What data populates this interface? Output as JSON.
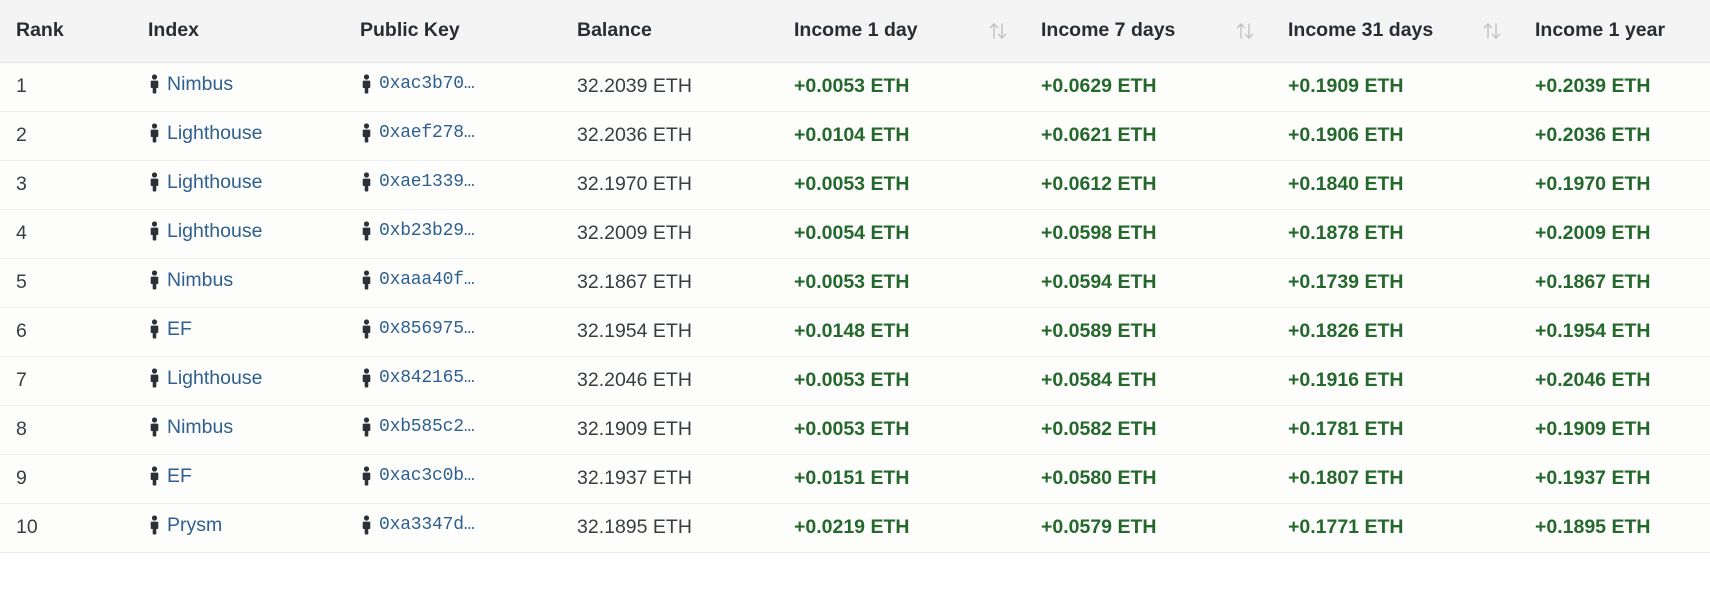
{
  "table": {
    "columns": [
      {
        "key": "rank",
        "label": "Rank",
        "sortable": false
      },
      {
        "key": "index",
        "label": "Index",
        "sortable": false
      },
      {
        "key": "pubkey",
        "label": "Public Key",
        "sortable": false
      },
      {
        "key": "balance",
        "label": "Balance",
        "sortable": false
      },
      {
        "key": "income1d",
        "label": "Income 1 day",
        "sortable": true
      },
      {
        "key": "income7d",
        "label": "Income 7 days",
        "sortable": true
      },
      {
        "key": "income31d",
        "label": "Income 31 days",
        "sortable": true
      },
      {
        "key": "income1y",
        "label": "Income 1 year",
        "sortable": true
      }
    ],
    "sort_icon_name": "sort-updown-icon",
    "row_icon_name": "validator-person-icon",
    "colors": {
      "header_bg": "#f4f4f4",
      "row_bg": "#fdfdfc",
      "link": "#2e5f8f",
      "income_positive": "#24682c",
      "text": "#383d42",
      "border": "#ededed",
      "icon": "#2c3138"
    },
    "rows": [
      {
        "rank": "1",
        "index": "Nimbus",
        "pubkey": "0xac3b70…",
        "balance": "32.2039 ETH",
        "income1d": "+0.0053 ETH",
        "income7d": "+0.0629 ETH",
        "income31d": "+0.1909 ETH",
        "income1y": "+0.2039 ETH"
      },
      {
        "rank": "2",
        "index": "Lighthouse",
        "pubkey": "0xaef278…",
        "balance": "32.2036 ETH",
        "income1d": "+0.0104 ETH",
        "income7d": "+0.0621 ETH",
        "income31d": "+0.1906 ETH",
        "income1y": "+0.2036 ETH"
      },
      {
        "rank": "3",
        "index": "Lighthouse",
        "pubkey": "0xae1339…",
        "balance": "32.1970 ETH",
        "income1d": "+0.0053 ETH",
        "income7d": "+0.0612 ETH",
        "income31d": "+0.1840 ETH",
        "income1y": "+0.1970 ETH"
      },
      {
        "rank": "4",
        "index": "Lighthouse",
        "pubkey": "0xb23b29…",
        "balance": "32.2009 ETH",
        "income1d": "+0.0054 ETH",
        "income7d": "+0.0598 ETH",
        "income31d": "+0.1878 ETH",
        "income1y": "+0.2009 ETH"
      },
      {
        "rank": "5",
        "index": "Nimbus",
        "pubkey": "0xaaa40f…",
        "balance": "32.1867 ETH",
        "income1d": "+0.0053 ETH",
        "income7d": "+0.0594 ETH",
        "income31d": "+0.1739 ETH",
        "income1y": "+0.1867 ETH"
      },
      {
        "rank": "6",
        "index": "EF",
        "pubkey": "0x856975…",
        "balance": "32.1954 ETH",
        "income1d": "+0.0148 ETH",
        "income7d": "+0.0589 ETH",
        "income31d": "+0.1826 ETH",
        "income1y": "+0.1954 ETH"
      },
      {
        "rank": "7",
        "index": "Lighthouse",
        "pubkey": "0x842165…",
        "balance": "32.2046 ETH",
        "income1d": "+0.0053 ETH",
        "income7d": "+0.0584 ETH",
        "income31d": "+0.1916 ETH",
        "income1y": "+0.2046 ETH"
      },
      {
        "rank": "8",
        "index": "Nimbus",
        "pubkey": "0xb585c2…",
        "balance": "32.1909 ETH",
        "income1d": "+0.0053 ETH",
        "income7d": "+0.0582 ETH",
        "income31d": "+0.1781 ETH",
        "income1y": "+0.1909 ETH"
      },
      {
        "rank": "9",
        "index": "EF",
        "pubkey": "0xac3c0b…",
        "balance": "32.1937 ETH",
        "income1d": "+0.0151 ETH",
        "income7d": "+0.0580 ETH",
        "income31d": "+0.1807 ETH",
        "income1y": "+0.1937 ETH"
      },
      {
        "rank": "10",
        "index": "Prysm",
        "pubkey": "0xa3347d…",
        "balance": "32.1895 ETH",
        "income1d": "+0.0219 ETH",
        "income7d": "+0.0579 ETH",
        "income31d": "+0.1771 ETH",
        "income1y": "+0.1895 ETH"
      }
    ]
  }
}
